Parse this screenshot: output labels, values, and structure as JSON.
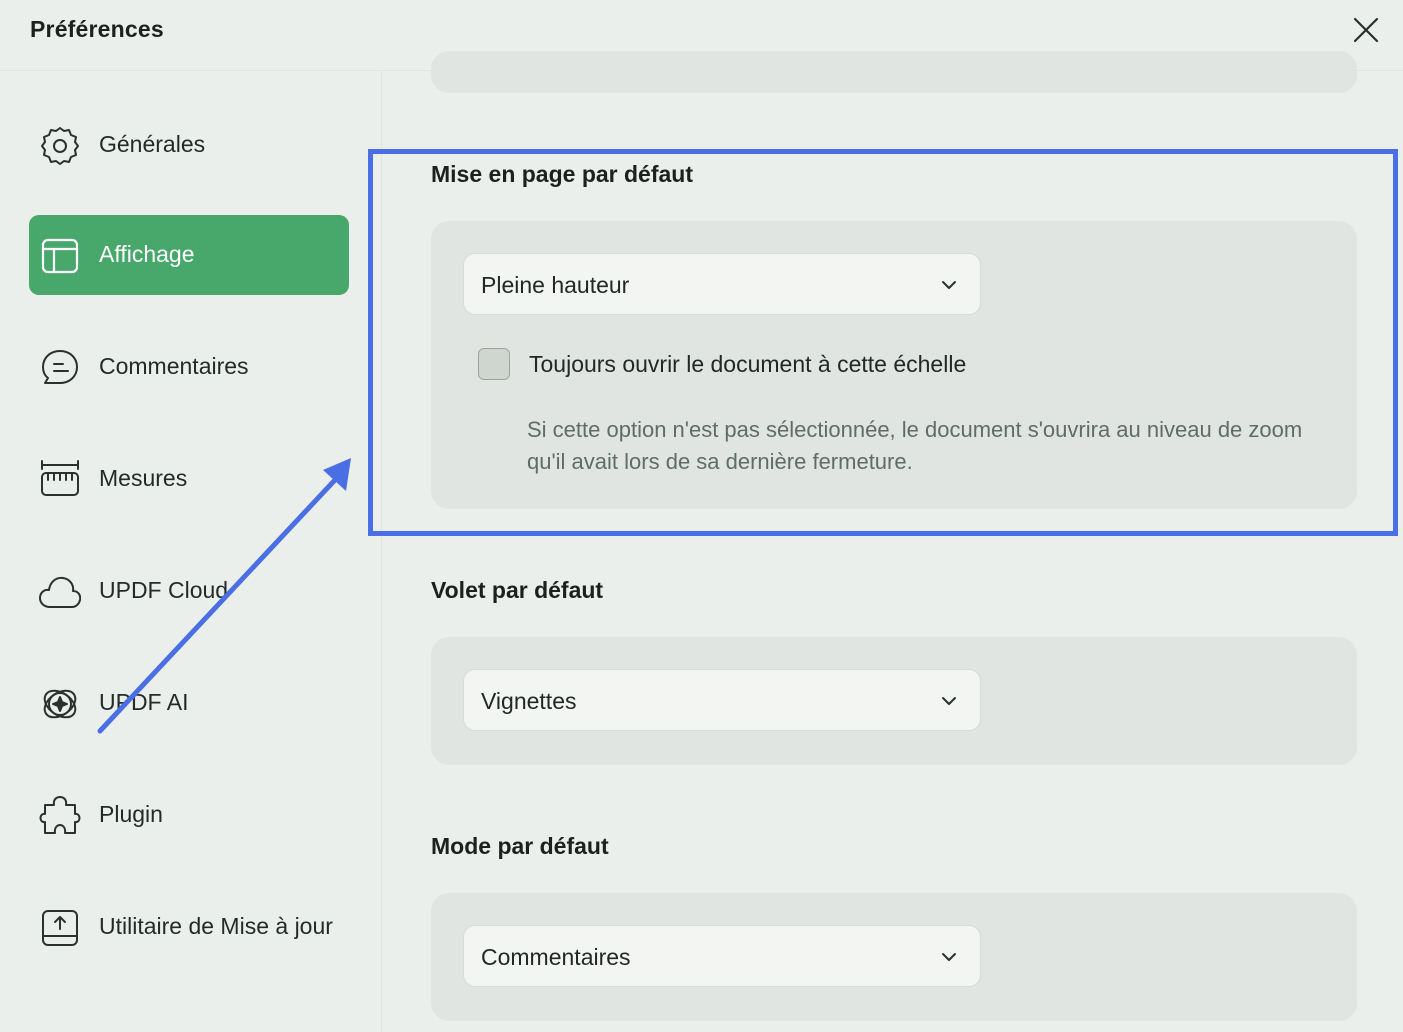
{
  "window": {
    "title": "Préférences"
  },
  "sidebar": {
    "items": [
      {
        "label": "Générales",
        "icon": "gear-icon"
      },
      {
        "label": "Affichage",
        "icon": "layout-icon",
        "active": true
      },
      {
        "label": "Commentaires",
        "icon": "comment-icon"
      },
      {
        "label": "Mesures",
        "icon": "ruler-icon"
      },
      {
        "label": "UPDF Cloud",
        "icon": "cloud-icon"
      },
      {
        "label": "UPDF AI",
        "icon": "ai-icon"
      },
      {
        "label": "Plugin",
        "icon": "puzzle-icon"
      },
      {
        "label": "Utilitaire de Mise à jour",
        "icon": "update-icon"
      }
    ]
  },
  "layout_section": {
    "title": "Mise en page par défaut",
    "select_value": "Pleine hauteur",
    "checkbox_label": "Toujours ouvrir le document à cette échelle",
    "checkbox_checked": false,
    "hint": "Si cette option n'est pas sélectionnée, le document s'ouvrira au niveau de zoom qu'il avait lors de sa dernière fermeture."
  },
  "pane_section": {
    "title": "Volet par défaut",
    "select_value": "Vignettes"
  },
  "mode_section": {
    "title": "Mode par défaut",
    "select_value": "Commentaires"
  },
  "colors": {
    "accent": "#48a86b",
    "annotation": "#4a6ee3"
  }
}
